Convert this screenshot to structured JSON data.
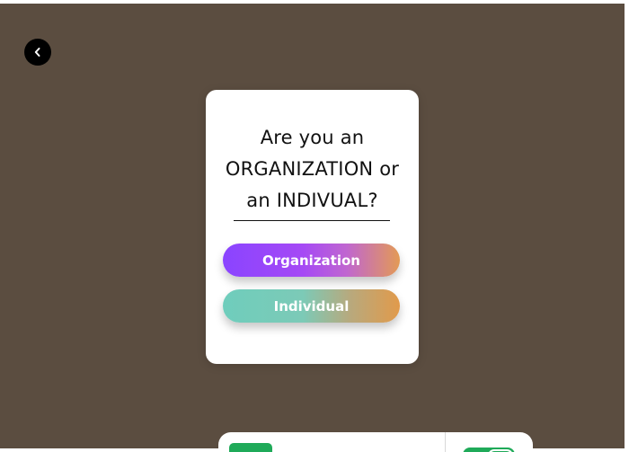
{
  "modal": {
    "title_line1": "Are you an",
    "title_line2": "ORGANIZATION or",
    "title_line3": "an INDIVUAL?",
    "options": [
      {
        "label": "Organization"
      },
      {
        "label": "Individual"
      }
    ]
  },
  "icons": {
    "back": "chevron-left-icon"
  },
  "colors": {
    "backdrop": "#5b4d40",
    "modal_background": "#ffffff",
    "organization_gradient": [
      "#8a44ff",
      "#e39a55"
    ],
    "individual_gradient": [
      "#6fcdbc",
      "#e19a4b"
    ],
    "toggle_green": "#1faa59"
  }
}
